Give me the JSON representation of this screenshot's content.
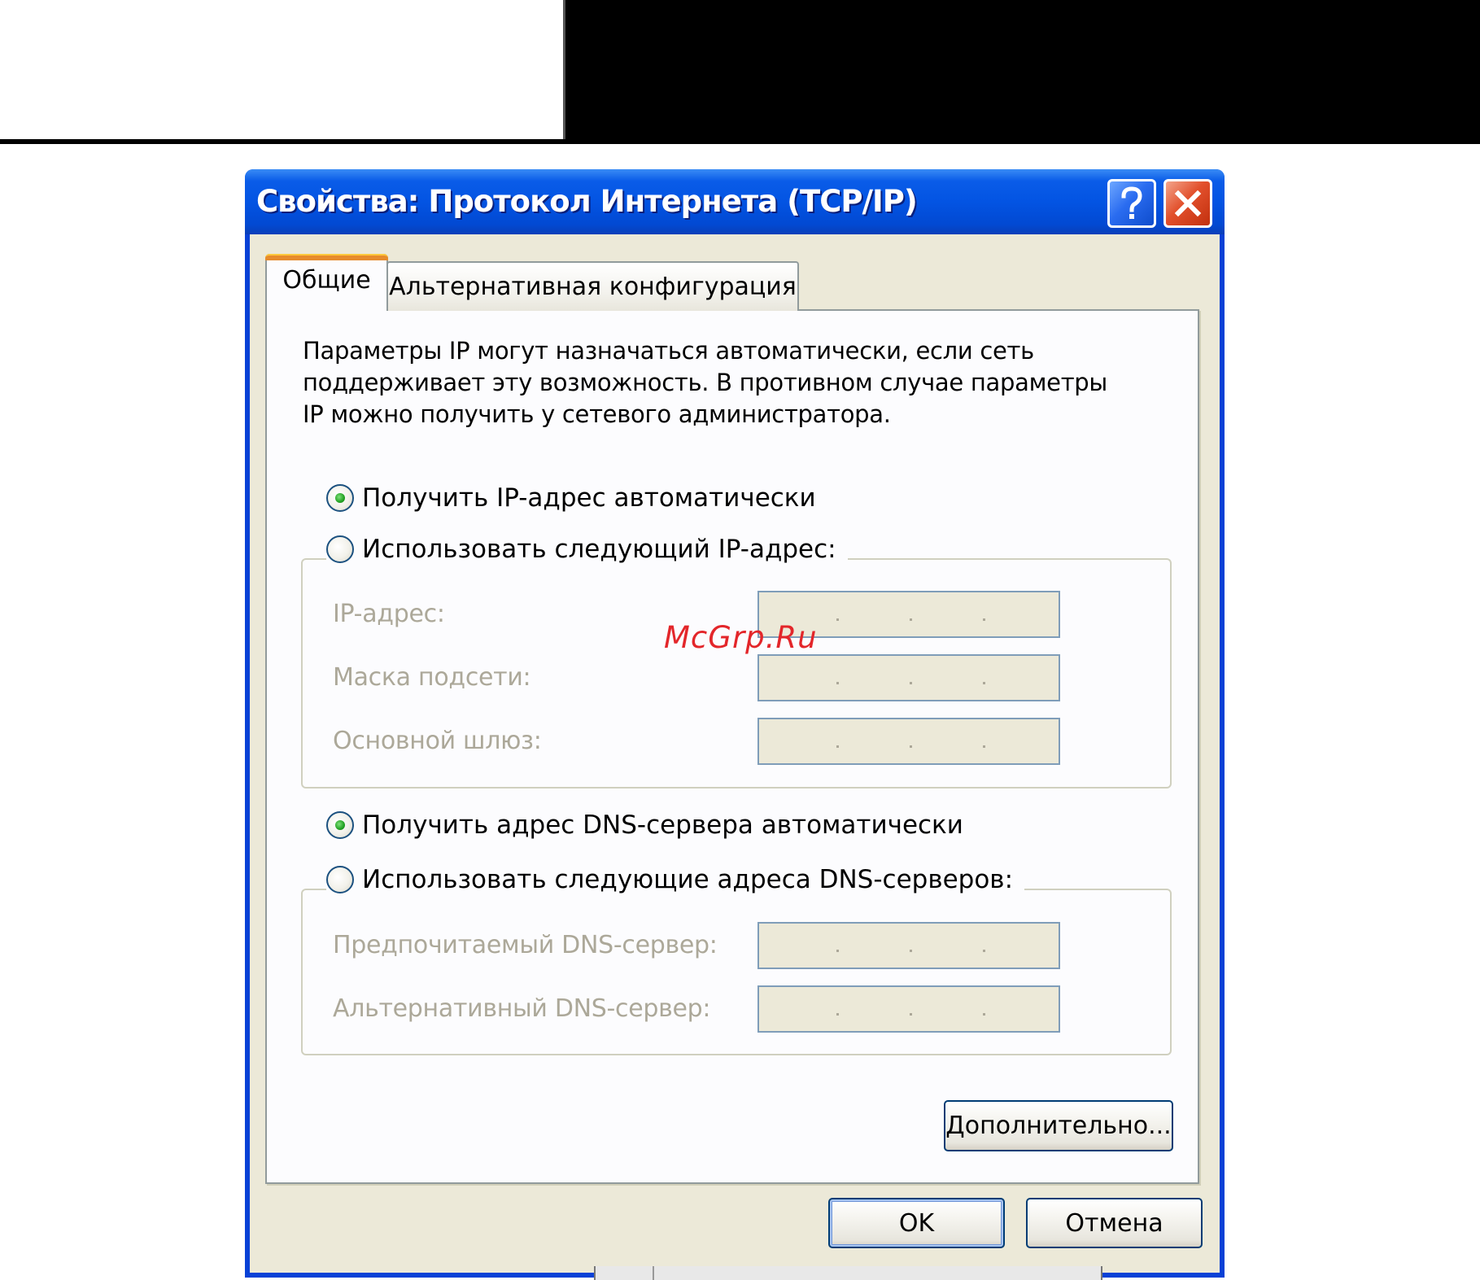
{
  "window": {
    "title": "Свойства: Протокол Интернета (TCP/IP)",
    "help_icon": "question-mark-icon",
    "close_icon": "close-x-icon"
  },
  "tabs": [
    {
      "label": "Общие",
      "active": true
    },
    {
      "label": "Альтернативная конфигурация",
      "active": false
    }
  ],
  "description": {
    "line1": "Параметры IP могут назначаться автоматически, если сеть",
    "line2": "поддерживает эту возможность. В противном случае параметры",
    "line3": "IP можно получить у сетевого администратора."
  },
  "ip": {
    "auto_label": "Получить IP-адрес автоматически",
    "auto_selected": true,
    "manual_label": "Использовать следующий IP-адрес:",
    "manual_selected": false,
    "fields": [
      {
        "label": "IP-адрес:",
        "value": ""
      },
      {
        "label": "Маска подсети:",
        "value": ""
      },
      {
        "label": "Основной шлюз:",
        "value": ""
      }
    ]
  },
  "dns": {
    "auto_label": "Получить адрес DNS-сервера автоматически",
    "auto_selected": true,
    "manual_label": "Использовать следующие адреса DNS-серверов:",
    "manual_selected": false,
    "fields": [
      {
        "label": "Предпочитаемый DNS-сервер:",
        "value": ""
      },
      {
        "label": "Альтернативный DNS-сервер:",
        "value": ""
      }
    ]
  },
  "buttons": {
    "advanced": "Дополнительно...",
    "ok": "OK",
    "cancel": "Отмена"
  },
  "watermark": "McGrp.Ru",
  "colors": {
    "titlebar": "#0354e3",
    "close_button": "#e2502c",
    "face": "#ece9d8",
    "disabled_text": "#aca899",
    "watermark": "#e3262a"
  }
}
